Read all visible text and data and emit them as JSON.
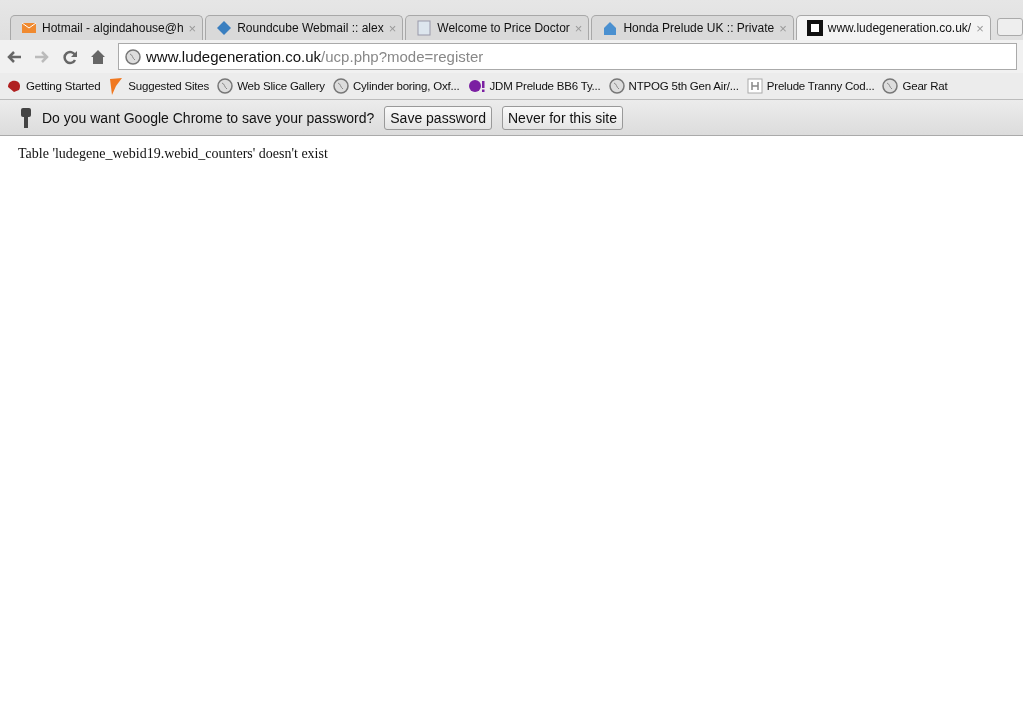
{
  "tabs": [
    {
      "title": "Hotmail - algindahouse@h",
      "selected": false,
      "close": "×"
    },
    {
      "title": "Roundcube Webmail :: alex",
      "selected": false,
      "close": "×"
    },
    {
      "title": "Welcome to Price Doctor",
      "selected": false,
      "close": "×"
    },
    {
      "title": "Honda Prelude UK :: Private",
      "selected": false,
      "close": "×"
    },
    {
      "title": "www.ludegeneration.co.uk/",
      "selected": true,
      "close": "×"
    }
  ],
  "address": {
    "host": "www.ludegeneration.co.uk",
    "path": "/ucp.php?mode=register"
  },
  "bookmarks": [
    {
      "label": "Getting Started"
    },
    {
      "label": "Suggested Sites"
    },
    {
      "label": "Web Slice Gallery"
    },
    {
      "label": "Cylinder boring, Oxf..."
    },
    {
      "label": "JDM Prelude BB6 Ty..."
    },
    {
      "label": "NTPOG 5th Gen Air/..."
    },
    {
      "label": "Prelude Tranny Cod..."
    },
    {
      "label": "Gear Rat"
    }
  ],
  "infobar": {
    "message": "Do you want Google Chrome to save your password?",
    "buttons": [
      "Save password",
      "Never for this site"
    ]
  },
  "page": {
    "error": "Table 'ludegene_webid19.webid_counters' doesn't exist"
  }
}
